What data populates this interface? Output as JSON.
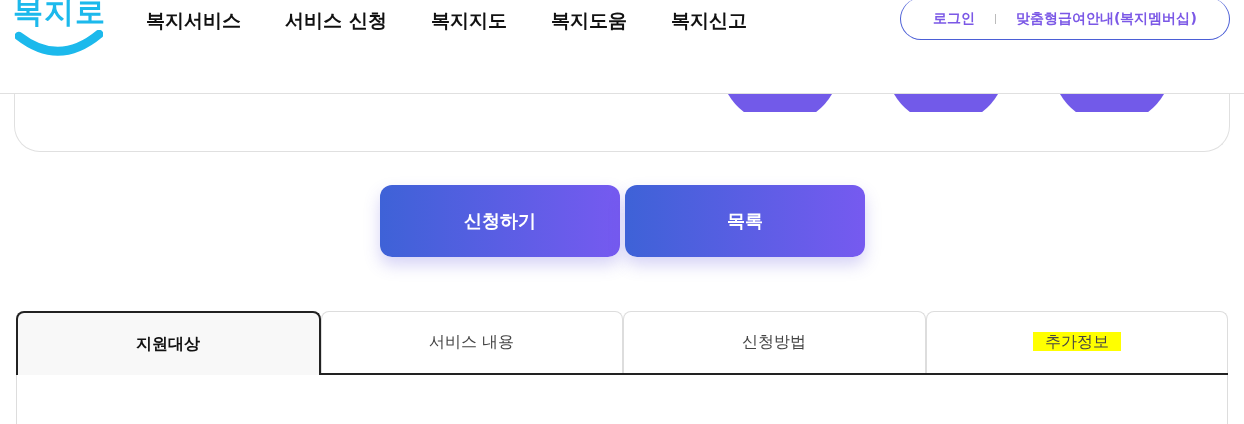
{
  "header": {
    "logo": "복지로",
    "nav": [
      "복지서비스",
      "서비스 신청",
      "복지지도",
      "복지도움",
      "복지신고"
    ],
    "account_links": [
      "로그인",
      "맞춤형급여안내(복지멤버십)"
    ]
  },
  "summary_card": {
    "circles": [
      {
        "kind": "picture"
      },
      {
        "kind": "picture"
      },
      {
        "kind": "picture"
      }
    ]
  },
  "actions": [
    "신청하기",
    "목록"
  ],
  "tabs": [
    {
      "label": "지원대상",
      "selected": true,
      "highlighted": false
    },
    {
      "label": "서비스 내용",
      "selected": false,
      "highlighted": false
    },
    {
      "label": "신청방법",
      "selected": false,
      "highlighted": false
    },
    {
      "label": "추가정보",
      "selected": false,
      "highlighted": true
    }
  ]
}
